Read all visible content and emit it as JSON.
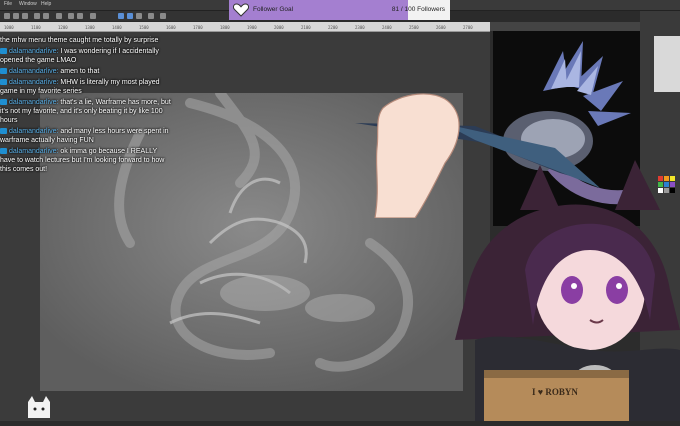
{
  "menu": {
    "items": [
      "File",
      "Window",
      "Help"
    ]
  },
  "ruler": {
    "ticks": [
      "1000",
      "1100",
      "1200",
      "1300",
      "1400",
      "1500",
      "1600",
      "1700",
      "1800",
      "1900",
      "2000",
      "2100",
      "2200",
      "2300",
      "2400",
      "2500",
      "2600",
      "2700"
    ]
  },
  "goal": {
    "label": "Follower Goal",
    "count": "81 / 100 Followers",
    "progress": 0.81,
    "color": "#a47fd0"
  },
  "chat": {
    "messages": [
      {
        "user": "",
        "text": "caught me totally by surprise",
        "prefix": "the mhw menu theme",
        "badge": false
      },
      {
        "user": "dalamandarlive:",
        "text": "I was wondering if I accidentally opened the game LMAO",
        "badge": true
      },
      {
        "user": "dalamandarlive:",
        "text": "amen to that",
        "badge": true
      },
      {
        "user": "dalamandarlive:",
        "text": "MHW is literally my most played game in my favorite series",
        "badge": true
      },
      {
        "user": "dalamandarlive:",
        "text": "that's a lie, Warframe has more, but it's not my favorite, and it's only beating it by like 100 hours",
        "badge": true
      },
      {
        "user": "dalamandarlive:",
        "text": "and many less hours were spent in warframe actually having FUN",
        "badge": true
      },
      {
        "user": "dalamandarlive:",
        "text": "ok imma go because I REALLY have to watch lectures but I'm looking forward to how this comes out!",
        "badge": true
      }
    ],
    "badge_color": "#1f8fd1",
    "username_color": "#5ab0e8"
  },
  "sign": {
    "text": "I ♥ ROBYN"
  }
}
